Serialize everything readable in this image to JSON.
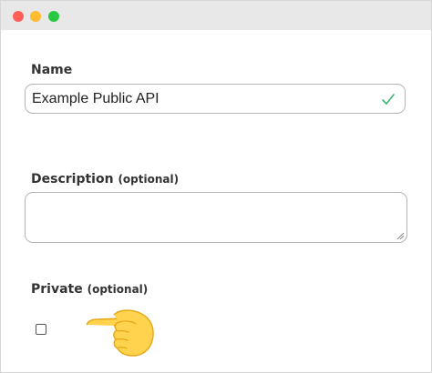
{
  "window": {
    "controls": [
      "close",
      "minimize",
      "maximize"
    ],
    "colors": {
      "close": "#fe5f57",
      "minimize": "#febc2e",
      "maximize": "#28c840"
    }
  },
  "form": {
    "name": {
      "label": "Name",
      "value": "Example Public API",
      "valid_icon": "checkmark-icon",
      "valid_color": "#3cb371"
    },
    "description": {
      "label": "Description",
      "optional": "(optional)",
      "value": ""
    },
    "private": {
      "label": "Private",
      "optional": "(optional)",
      "checked": false,
      "pointer_icon": "pointing-hand-icon"
    }
  }
}
